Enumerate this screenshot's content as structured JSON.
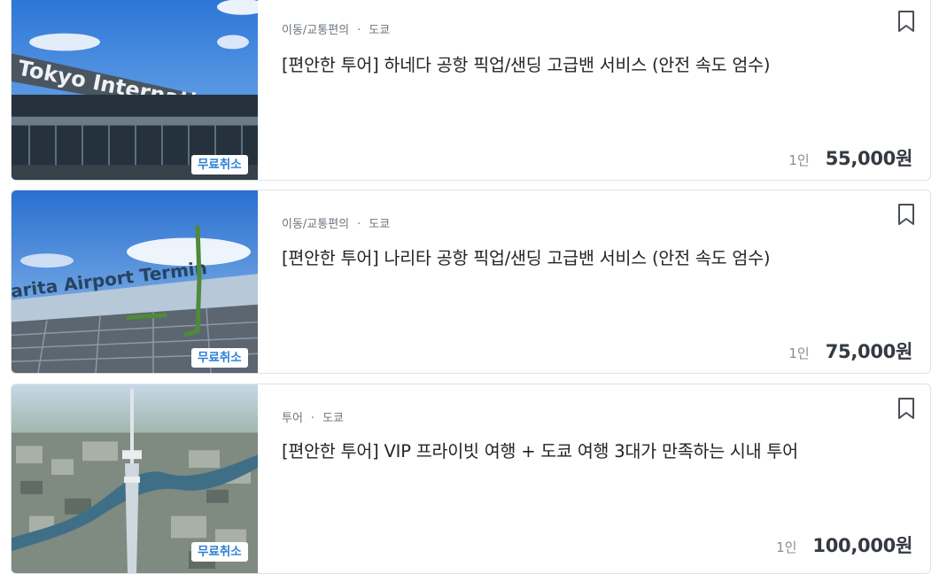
{
  "listings": [
    {
      "category": "이동/교통편의",
      "city": "도쿄",
      "title": "[편안한 투어] 하네다 공항 픽업/샌딩 고급밴 서비스 (안전 속도 엄수)",
      "badge": "무료취소",
      "per": "1인",
      "price": "55,000원",
      "image_sign_text": "Tokyo International Air"
    },
    {
      "category": "이동/교통편의",
      "city": "도쿄",
      "title": "[편안한 투어] 나리타 공항 픽업/샌딩 고급밴 서비스 (안전 속도 엄수)",
      "badge": "무료취소",
      "per": "1인",
      "price": "75,000원",
      "image_sign_text": "arita Airport Termin"
    },
    {
      "category": "투어",
      "city": "도쿄",
      "title": "[편안한 투어] VIP 프라이빗 여행 + 도쿄 여행 3대가 만족하는 시내 투어",
      "badge": "무료취소",
      "per": "1인",
      "price": "100,000원"
    }
  ],
  "separator": "·",
  "icons": {
    "bookmark": "bookmark-icon"
  },
  "colors": {
    "badge_text": "#2b7fd6",
    "card_border": "#dee2e6",
    "title_text": "#212529",
    "meta_text": "#6c757d",
    "price_text": "#343a40"
  }
}
